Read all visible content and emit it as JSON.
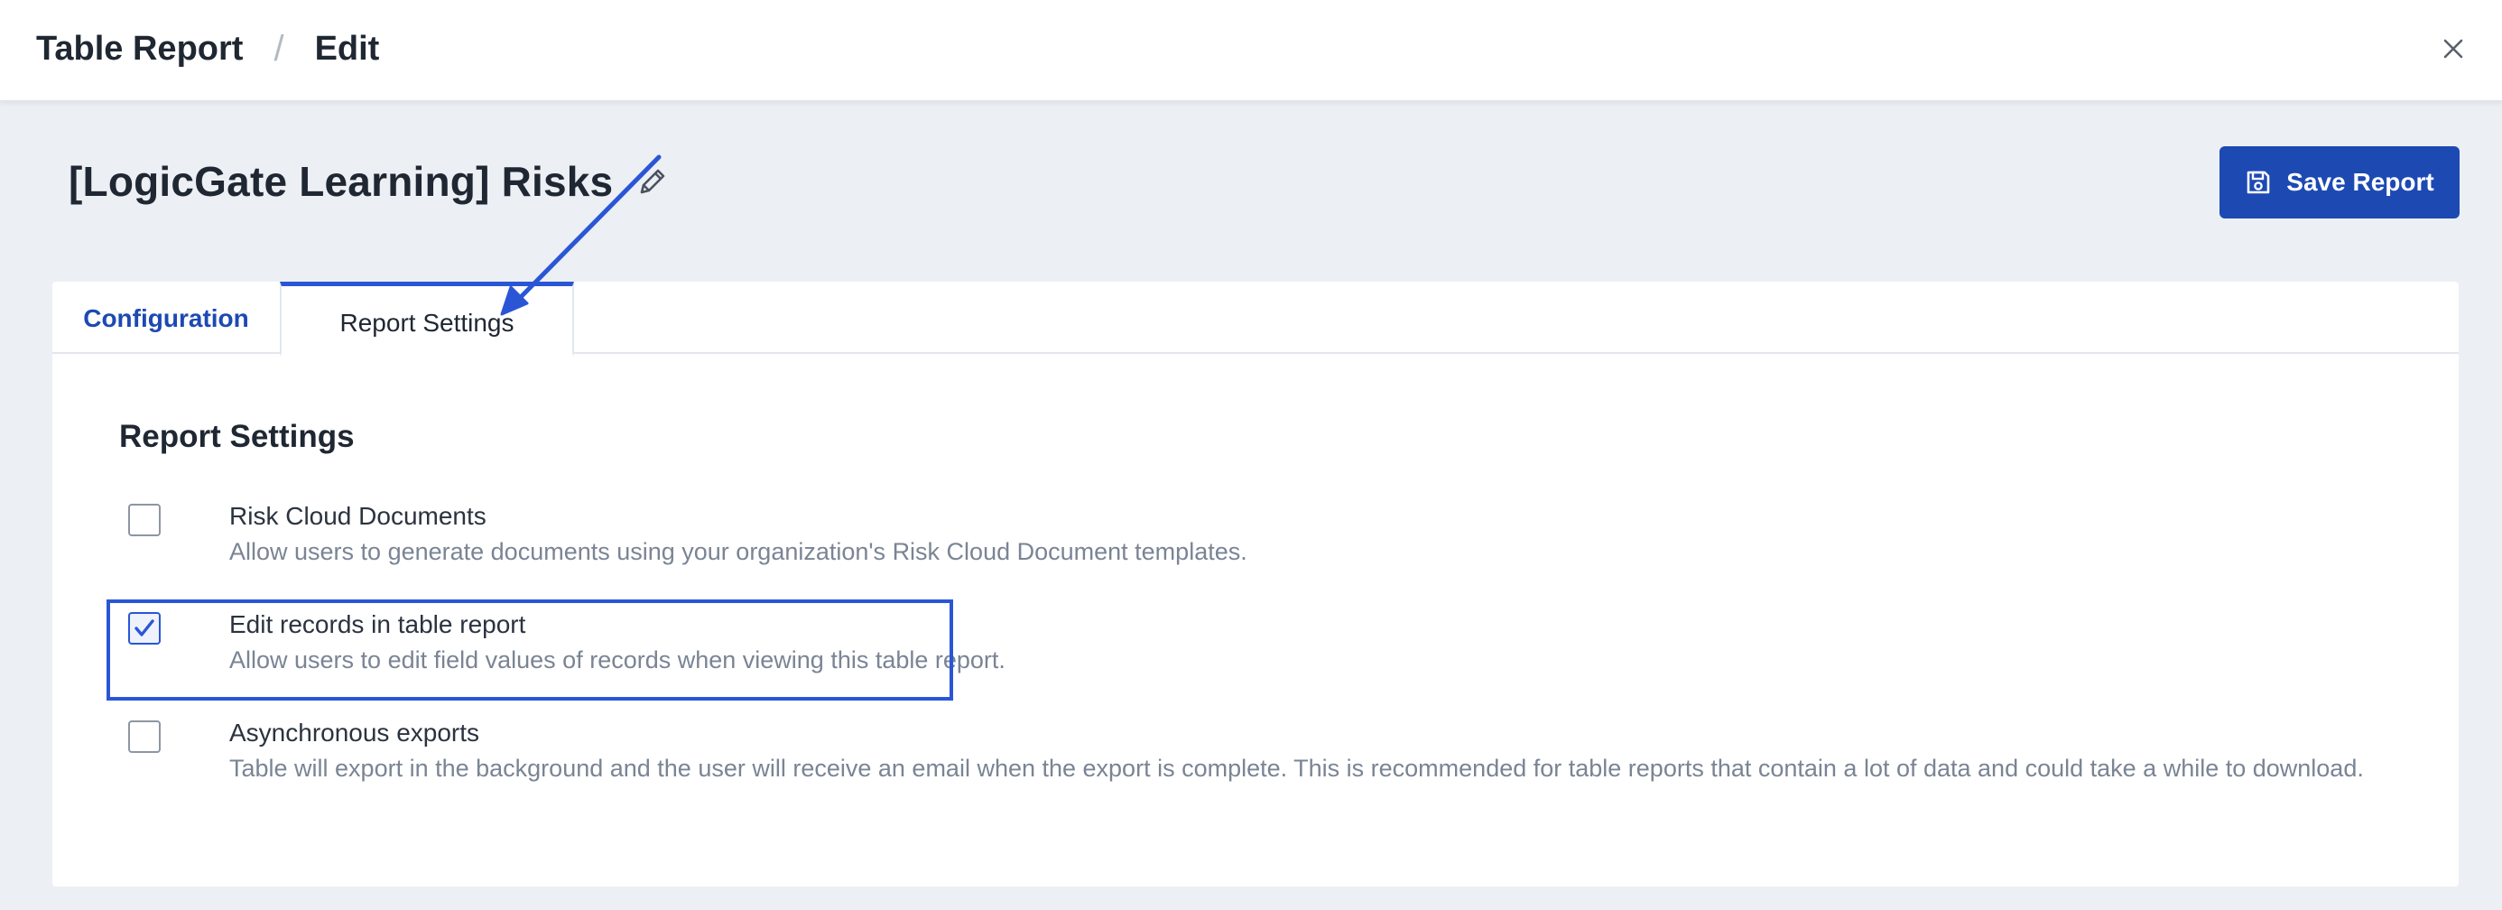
{
  "breadcrumb": {
    "parent": "Table Report",
    "separator": "/",
    "current": "Edit"
  },
  "page": {
    "title": "[LogicGate Learning] Risks"
  },
  "actions": {
    "save_label": "Save Report"
  },
  "tabs": [
    {
      "label": "Configuration",
      "active": false
    },
    {
      "label": "Report Settings",
      "active": true
    }
  ],
  "settings": {
    "title": "Report Settings",
    "options": [
      {
        "label": "Risk Cloud Documents",
        "description": "Allow users to generate documents using your organization's Risk Cloud Document templates.",
        "checked": false
      },
      {
        "label": "Edit records in table report",
        "description": "Allow users to edit field values of records when viewing this table report.",
        "checked": true
      },
      {
        "label": "Asynchronous exports",
        "description": "Table will export in the background and the user will receive an email when the export is complete. This is recommended for table reports that contain a lot of data and could take a while to download.",
        "checked": false
      }
    ]
  },
  "colors": {
    "primary": "#1d49b3",
    "accent": "#2a56d6",
    "background": "#eceff4",
    "muted_text": "#7a8494"
  },
  "icons": {
    "close": "close-icon",
    "edit_title": "pencil-icon",
    "save": "floppy-disk-icon",
    "check": "checkmark-icon"
  }
}
